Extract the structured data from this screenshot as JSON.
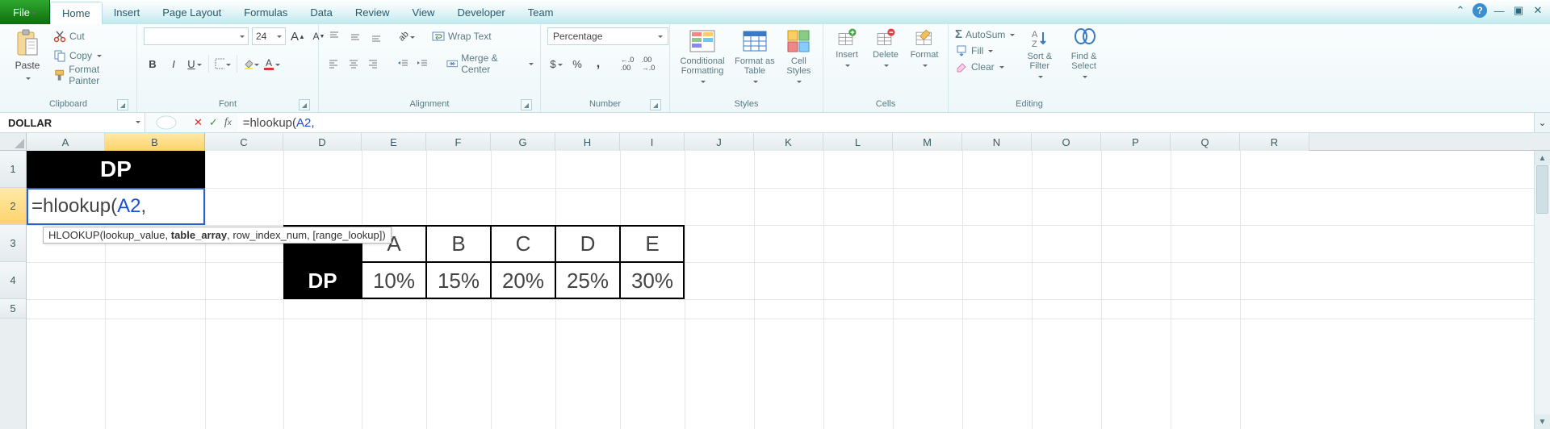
{
  "menu": {
    "file": "File",
    "tabs": [
      "Home",
      "Insert",
      "Page Layout",
      "Formulas",
      "Data",
      "Review",
      "View",
      "Developer",
      "Team"
    ],
    "active": "Home"
  },
  "ribbon": {
    "clipboard": {
      "label": "Clipboard",
      "paste": "Paste",
      "cut": "Cut",
      "copy": "Copy",
      "painter": "Format Painter"
    },
    "font": {
      "label": "Font",
      "size": "24",
      "increase": "A",
      "decrease": "A",
      "bold": "B",
      "italic": "I",
      "underline": "U",
      "fontcolor": "A"
    },
    "alignment": {
      "label": "Alignment",
      "wrap": "Wrap Text",
      "merge": "Merge & Center"
    },
    "number": {
      "label": "Number",
      "format": "Percentage",
      "dollar": "$",
      "percent": "%",
      "comma": ",",
      "incdec": ".00",
      "decdec": ".00"
    },
    "styles": {
      "label": "Styles",
      "cond": "Conditional Formatting",
      "table": "Format as Table",
      "cell": "Cell Styles"
    },
    "cells": {
      "label": "Cells",
      "insert": "Insert",
      "delete": "Delete",
      "format": "Format"
    },
    "editing": {
      "label": "Editing",
      "autosum": "AutoSum",
      "fill": "Fill",
      "clear": "Clear",
      "sort": "Sort & Filter",
      "find": "Find & Select"
    }
  },
  "fbar": {
    "name": "DOLLAR",
    "formula_pre": "=hlookup(",
    "formula_ref": "A2",
    "formula_post": ","
  },
  "tooltip": {
    "pre": "HLOOKUP(lookup_value, ",
    "bold": "table_array",
    "post": ", row_index_num, [range_lookup])"
  },
  "columns": [
    "A",
    "B",
    "C",
    "D",
    "E",
    "F",
    "G",
    "H",
    "I",
    "J",
    "K",
    "L",
    "M",
    "N",
    "O",
    "P",
    "Q",
    "R"
  ],
  "rows": [
    "1",
    "2",
    "3",
    "4",
    "5"
  ],
  "cells": {
    "b1": "DP",
    "a2_pre": "=hlookup(",
    "a2_ref": "A2",
    "a2_post": ",",
    "d4": "DP",
    "e3": "A",
    "f3": "B",
    "g3": "C",
    "h3": "D",
    "i3": "E",
    "e4": "10%",
    "f4": "15%",
    "g4": "20%",
    "h4": "25%",
    "i4": "30%"
  },
  "icons": {
    "sigma": "Σ"
  }
}
